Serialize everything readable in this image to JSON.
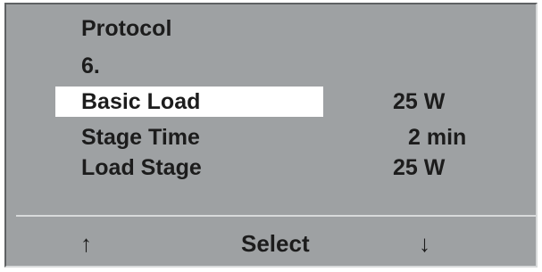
{
  "screen": {
    "title": "Protocol",
    "protocol_number": "6.",
    "rows": [
      {
        "label": "Basic Load",
        "value": "25 W",
        "selected": true
      },
      {
        "label": "Stage Time",
        "value": "2 min",
        "selected": false
      },
      {
        "label": "Load Stage",
        "value": "25 W",
        "selected": false
      }
    ]
  },
  "softkeys": {
    "up_glyph": "↑",
    "select_label": "Select",
    "down_glyph": "↓"
  },
  "colors": {
    "lcd_background": "#9ea1a3",
    "text": "#1c1c1c",
    "selection_highlight": "#ffffff"
  }
}
